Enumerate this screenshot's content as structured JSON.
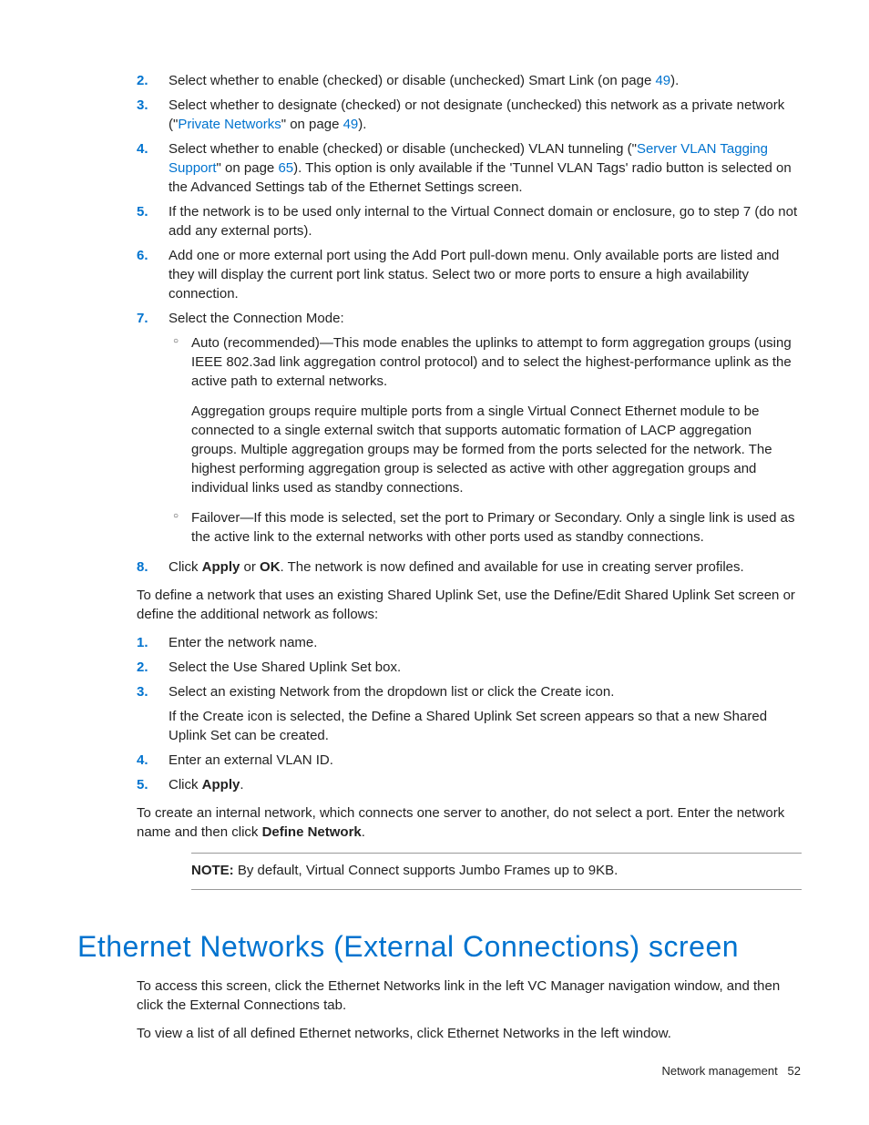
{
  "list1": {
    "i2": {
      "num": "2.",
      "t1": "Select whether to enable (checked) or disable (unchecked) Smart Link (on page ",
      "link": "49",
      "t2": ")."
    },
    "i3": {
      "num": "3.",
      "t1": "Select whether to designate (checked) or not designate (unchecked) this network as a private network (\"",
      "link1": "Private Networks",
      "t2": "\" on page ",
      "link2": "49",
      "t3": ")."
    },
    "i4": {
      "num": "4.",
      "t1": "Select whether to enable (checked) or disable (unchecked) VLAN tunneling (\"",
      "link1": "Server VLAN Tagging Support",
      "t2": "\" on page ",
      "link2": "65",
      "t3": "). This option is only available if the 'Tunnel VLAN Tags' radio button is selected on the Advanced Settings tab of the Ethernet Settings screen."
    },
    "i5": {
      "num": "5.",
      "t": "If the network is to be used only internal to the Virtual Connect domain or enclosure, go to step 7 (do not add any external ports)."
    },
    "i6": {
      "num": "6.",
      "t": "Add one or more external port using the Add Port pull-down menu. Only available ports are listed and they will display the current port link status. Select two or more ports to ensure a high availability connection."
    },
    "i7": {
      "num": "7.",
      "t": "Select the Connection Mode:",
      "sub": {
        "a": {
          "p1": "Auto (recommended)—This mode enables the uplinks to attempt to form aggregation groups (using IEEE 802.3ad link aggregation control protocol) and to select the highest-performance uplink as the active path to external networks.",
          "p2": "Aggregation groups require multiple ports from a single Virtual Connect Ethernet module to be connected to a single external switch that supports automatic formation of LACP aggregation groups. Multiple aggregation groups may be formed from the ports selected for the network. The highest performing aggregation group is selected as active with other aggregation groups and individual links used as standby connections."
        },
        "b": {
          "p1": "Failover—If this mode is selected, set the port to Primary or Secondary. Only a single link is used as the active link to the external networks with other ports used as standby connections."
        }
      }
    },
    "i8": {
      "num": "8.",
      "t1": "Click ",
      "b1": "Apply",
      "t2": " or ",
      "b2": "OK",
      "t3": ". The network is now defined and available for use in creating server profiles."
    }
  },
  "para1": "To define a network that uses an existing Shared Uplink Set, use the Define/Edit Shared Uplink Set screen or define the additional network as follows:",
  "list2": {
    "i1": {
      "num": "1.",
      "t": "Enter the network name."
    },
    "i2": {
      "num": "2.",
      "t": "Select the Use Shared Uplink Set box."
    },
    "i3": {
      "num": "3.",
      "t": "Select an existing Network from the dropdown list or click the Create icon.",
      "p2": "If the Create icon is selected, the Define a Shared Uplink Set screen appears so that a new Shared Uplink Set can be created."
    },
    "i4": {
      "num": "4.",
      "t": "Enter an external VLAN ID."
    },
    "i5": {
      "num": "5.",
      "t1": "Click ",
      "b1": "Apply",
      "t2": "."
    }
  },
  "para2": {
    "t1": "To create an internal network, which connects one server to another, do not select a port. Enter the network name and then click ",
    "b1": "Define Network",
    "t2": "."
  },
  "note": {
    "label": "NOTE:",
    "t": "  By default, Virtual Connect supports Jumbo Frames up to 9KB."
  },
  "heading": "Ethernet Networks (External Connections) screen",
  "para3": "To access this screen, click the Ethernet Networks link in the left VC Manager navigation window, and then click the External Connections tab.",
  "para4": "To view a list of all defined Ethernet networks, click Ethernet Networks in the left window.",
  "footer": {
    "section": "Network management",
    "page": "52"
  }
}
